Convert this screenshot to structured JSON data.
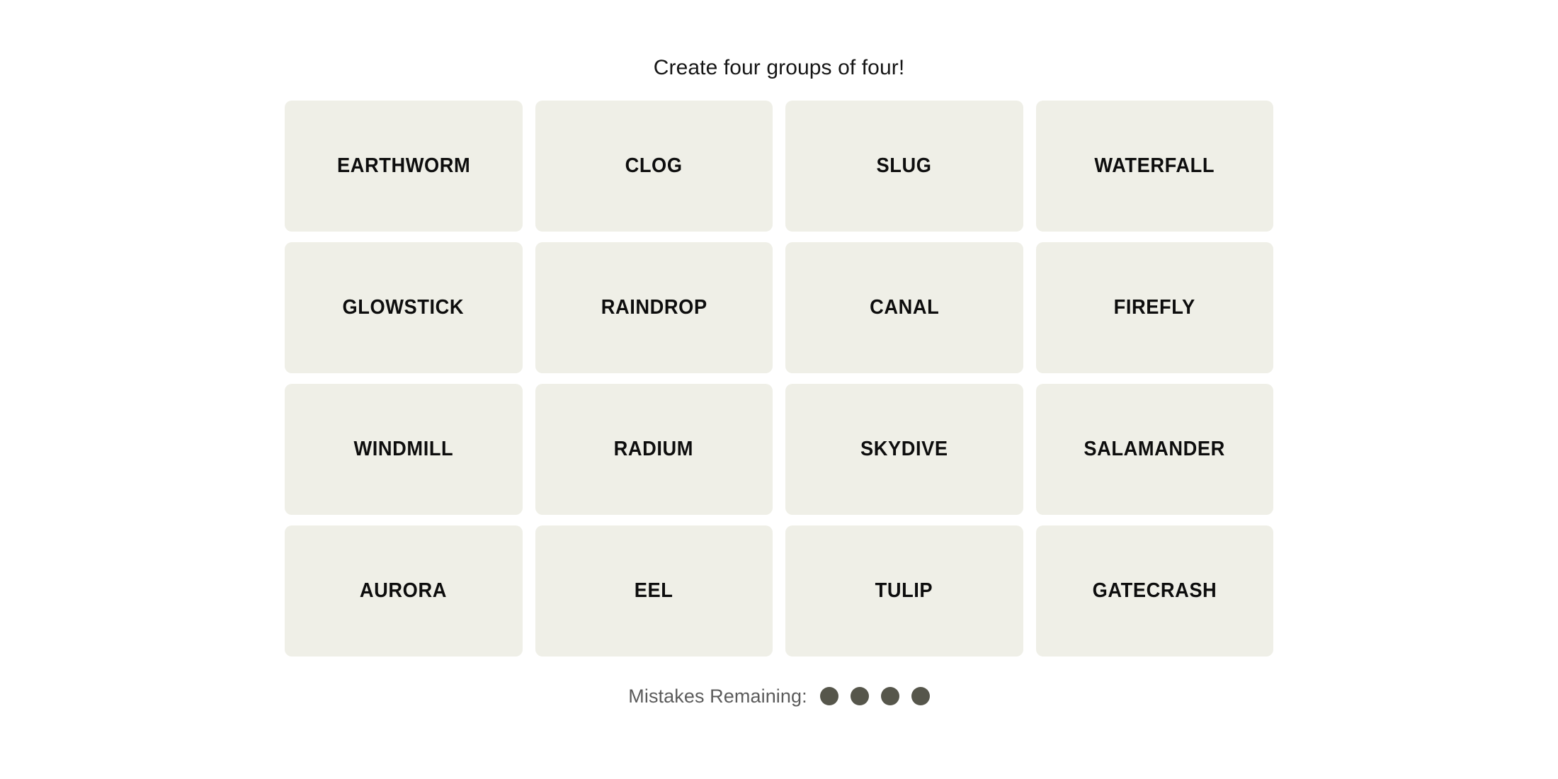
{
  "page": {
    "background_color": "#FFFFFF",
    "title": "Create four groups of four!"
  },
  "board": {
    "tile_color": "#EFEFE7",
    "tile_text_color": "#0D0D0D",
    "rows": [
      {
        "tiles": [
          {
            "label": "EARTHWORM"
          },
          {
            "label": "CLOG"
          },
          {
            "label": "SLUG"
          },
          {
            "label": "WATERFALL"
          }
        ]
      },
      {
        "tiles": [
          {
            "label": "GLOWSTICK"
          },
          {
            "label": "RAINDROP"
          },
          {
            "label": "CANAL"
          },
          {
            "label": "FIREFLY"
          }
        ]
      },
      {
        "tiles": [
          {
            "label": "WINDMILL"
          },
          {
            "label": "RADIUM"
          },
          {
            "label": "SKYDIVE"
          },
          {
            "label": "SALAMANDER"
          }
        ]
      },
      {
        "tiles": [
          {
            "label": "AURORA"
          },
          {
            "label": "EEL"
          },
          {
            "label": "TULIP"
          },
          {
            "label": "GATECRASH"
          }
        ]
      }
    ]
  },
  "footer": {
    "mistakes_label": "Mistakes Remaining:",
    "mistakes_remaining": 4,
    "dot_color": "#56564B",
    "label_color": "#5B5B5B",
    "dots": [
      {
        "state": "filled"
      },
      {
        "state": "filled"
      },
      {
        "state": "filled"
      },
      {
        "state": "filled"
      }
    ]
  }
}
